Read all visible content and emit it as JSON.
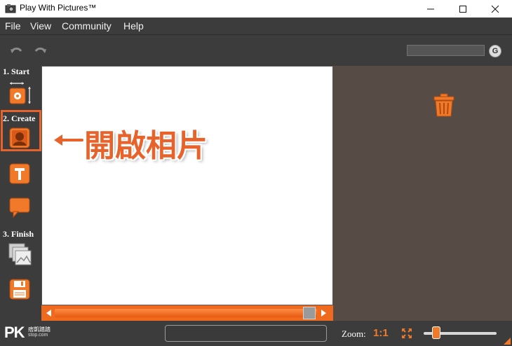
{
  "window": {
    "title": "Play With Pictures™",
    "minimize_icon": "minimize-icon",
    "maximize_icon": "maximize-icon",
    "close_icon": "close-icon"
  },
  "menu": {
    "items": [
      "File",
      "View",
      "Community",
      "Help"
    ]
  },
  "toolbar": {
    "undo_icon": "undo-icon",
    "redo_icon": "redo-icon",
    "search_value": "",
    "g_label": "G"
  },
  "steps": {
    "start": "1. Start",
    "create": "2. Create",
    "finish": "3. Finish"
  },
  "tools": [
    "resize-canvas-icon",
    "open-picture-icon",
    "text-tool-icon",
    "speech-bubble-icon",
    "gallery-icon",
    "save-icon"
  ],
  "annotation": {
    "text": "開啟相片",
    "color": "#e8632c"
  },
  "statusbar": {
    "logo": "PK",
    "logo_sub1": "痞凱踏踏",
    "logo_sub2": "stop.com",
    "status_text": "",
    "zoom_label": "Zoom:",
    "zoom_one_to_one": "1:1"
  },
  "colors": {
    "accent": "#ef6a1e",
    "panel": "#3c3c3c",
    "right_panel": "#574c45"
  }
}
